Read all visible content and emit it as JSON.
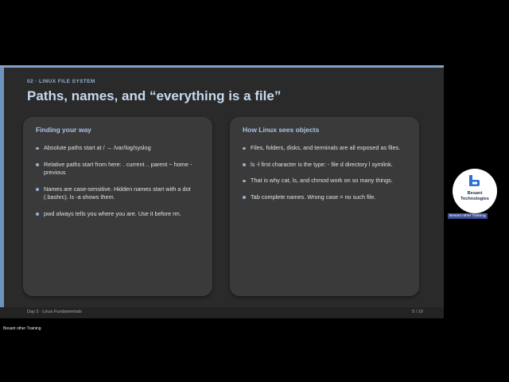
{
  "slide": {
    "eyebrow": "02 · LINUX FILE SYSTEM",
    "title": "Paths, names, and “everything is a file”",
    "cards": [
      {
        "title": "Finding your way",
        "bullets": [
          "Absolute paths start at /  →  /var/log/syslog",
          "Relative paths start from here: . current  .. parent  ~ home  - previous",
          "Names are case-sensitive. Hidden names start with a dot (.bashrc). ls -a shows them.",
          "pwd always tells you where you are. Use it before rm."
        ]
      },
      {
        "title": "How Linux sees objects",
        "bullets": [
          "Files, folders, disks, and terminals are all exposed as files.",
          "ls -l first character is the type: - file  d directory  l symlink.",
          "That is why cat, ls, and chmod work on so many things.",
          "Tab complete names. Wrong case = no such file."
        ]
      }
    ],
    "footer_left": "Day 3  ·  Linux Fundamentals",
    "footer_right": "5  /  10"
  },
  "logo": {
    "icon": "besant-b-logo-icon",
    "name_line1": "Besant",
    "name_line2": "Technologies",
    "caption": "Besant other Training"
  },
  "bottom_caption": "Besant other Training",
  "colors": {
    "slide_bg": "#2a2a2a",
    "card_bg": "#3a3a3a",
    "title": "#c6d9ef",
    "accent": "#6d93bb",
    "caption_bg": "#3d4e94"
  }
}
